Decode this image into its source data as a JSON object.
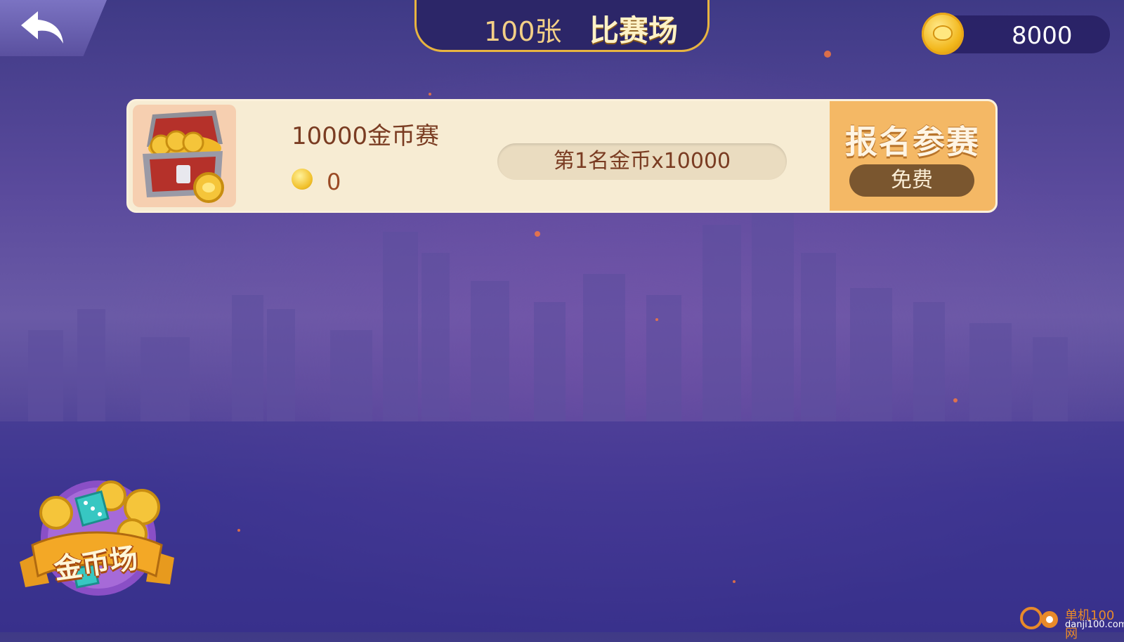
{
  "header": {
    "back": {
      "icon": "back-arrow-icon"
    },
    "title_sub": "100张",
    "title_main": "比赛场",
    "coins": {
      "icon": "gold-coin-icon",
      "value": "8000"
    }
  },
  "matches": [
    {
      "icon": "treasure-chest-icon",
      "title": "10000金币赛",
      "participants_icon": "player-count-icon",
      "participants": "0",
      "prize": "第1名金币x10000",
      "signup_label": "报名参赛",
      "fee": "免费"
    }
  ],
  "gold_room": {
    "icon": "dice-coins-icon",
    "label": "金币场"
  },
  "watermark": {
    "icon": "danji100-logo-icon",
    "text": "单机100网",
    "url": "danji100.com"
  },
  "colors": {
    "background": "#4a3f96",
    "card": "#f7ecd3",
    "signup": "#f4b865",
    "title_border": "#e8b440",
    "text_brown": "#7a3c22"
  }
}
